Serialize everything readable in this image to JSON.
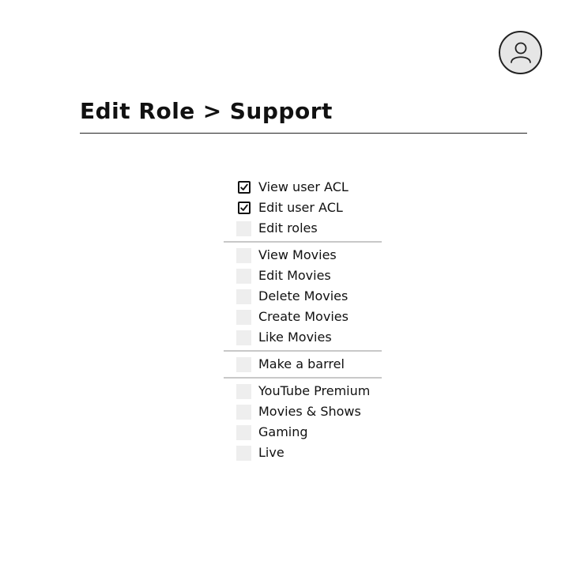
{
  "header": {
    "breadcrumb": [
      "Edit Role",
      "Support"
    ],
    "separator": ">"
  },
  "user_menu": {
    "icon": "user-icon"
  },
  "permissions": {
    "groups": [
      {
        "items": [
          {
            "label": "View user ACL",
            "checked": true
          },
          {
            "label": "Edit user ACL",
            "checked": true
          },
          {
            "label": "Edit roles",
            "checked": false
          }
        ]
      },
      {
        "items": [
          {
            "label": "View Movies",
            "checked": false
          },
          {
            "label": "Edit Movies",
            "checked": false
          },
          {
            "label": "Delete Movies",
            "checked": false
          },
          {
            "label": "Create Movies",
            "checked": false
          },
          {
            "label": "Like Movies",
            "checked": false
          }
        ]
      },
      {
        "items": [
          {
            "label": "Make a barrel",
            "checked": false
          }
        ]
      },
      {
        "items": [
          {
            "label": "YouTube Premium",
            "checked": false
          },
          {
            "label": "Movies & Shows",
            "checked": false
          },
          {
            "label": "Gaming",
            "checked": false
          },
          {
            "label": "Live",
            "checked": false
          }
        ]
      }
    ]
  }
}
